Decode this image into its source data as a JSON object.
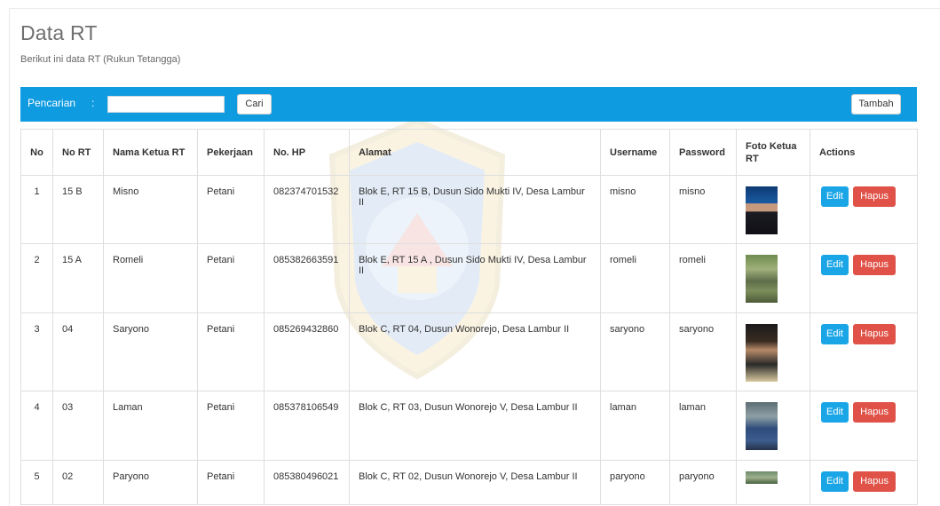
{
  "page": {
    "title": "Data RT",
    "subtitle": "Berikut ini data RT (Rukun Tetangga)"
  },
  "toolbar": {
    "search_label": "Pencarian",
    "colon": ":",
    "search_value": "",
    "search_button": "Cari",
    "add_button": "Tambah"
  },
  "table": {
    "headers": [
      "No",
      "No RT",
      "Nama Ketua RT",
      "Pekerjaan",
      "No. HP",
      "Alamat",
      "Username",
      "Password",
      "Foto Ketua RT",
      "Actions"
    ],
    "rows": [
      {
        "no": "1",
        "no_rt": "15 B",
        "nama": "Misno",
        "pekerjaan": "Petani",
        "hp": "082374701532",
        "alamat": "Blok E, RT 15 B, Dusun Sido Mukti IV, Desa Lambur II",
        "username": "misno",
        "password": "misno"
      },
      {
        "no": "2",
        "no_rt": "15 A",
        "nama": "Romeli",
        "pekerjaan": "Petani",
        "hp": "085382663591",
        "alamat": "Blok E, RT 15 A , Dusun Sido Mukti IV, Desa Lambur II",
        "username": "romeli",
        "password": "romeli"
      },
      {
        "no": "3",
        "no_rt": "04",
        "nama": "Saryono",
        "pekerjaan": "Petani",
        "hp": "085269432860",
        "alamat": "Blok C, RT 04, Dusun Wonorejo, Desa Lambur II",
        "username": "saryono",
        "password": "saryono"
      },
      {
        "no": "4",
        "no_rt": "03",
        "nama": "Laman",
        "pekerjaan": "Petani",
        "hp": "085378106549",
        "alamat": "Blok C, RT 03, Dusun Wonorejo V, Desa Lambur II",
        "username": "laman",
        "password": "laman"
      },
      {
        "no": "5",
        "no_rt": "02",
        "nama": "Paryono",
        "pekerjaan": "Petani",
        "hp": "085380496021",
        "alamat": "Blok C, RT 02, Dusun Wonorejo V, Desa Lambur II",
        "username": "paryono",
        "password": "paryono"
      }
    ],
    "edit_label": "Edit",
    "delete_label": "Hapus"
  },
  "colors": {
    "toolbar_bg": "#0e9be0",
    "edit_button": "#1aa5e6",
    "delete_button": "#e05248"
  }
}
